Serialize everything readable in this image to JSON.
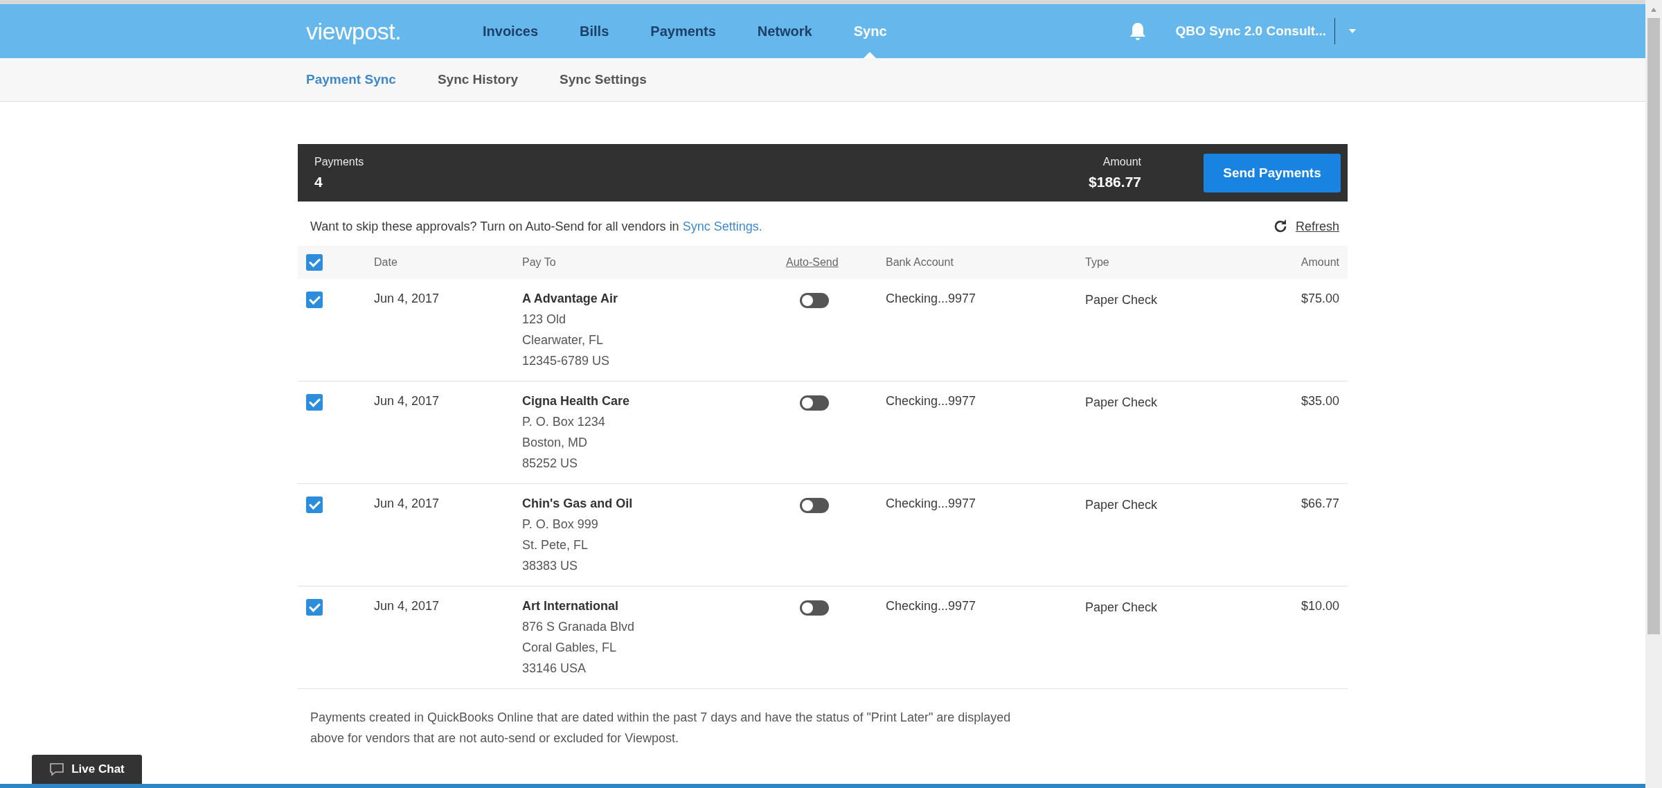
{
  "header": {
    "logo": "viewpost.",
    "nav": [
      {
        "label": "Invoices",
        "selected": false
      },
      {
        "label": "Bills",
        "selected": false
      },
      {
        "label": "Payments",
        "selected": false
      },
      {
        "label": "Network",
        "selected": false
      },
      {
        "label": "Sync",
        "selected": true
      }
    ],
    "account": "QBO Sync 2.0 Consult..."
  },
  "subnav": [
    {
      "label": "Payment Sync",
      "selected": true
    },
    {
      "label": "Sync History",
      "selected": false
    },
    {
      "label": "Sync Settings",
      "selected": false
    }
  ],
  "summary": {
    "payments_label": "Payments",
    "payments_count": "4",
    "amount_label": "Amount",
    "amount": "$186.77",
    "button": "Send Payments"
  },
  "notice": {
    "text": "Want to skip these approvals? Turn on Auto-Send for all vendors in ",
    "link": "Sync Settings.",
    "refresh": "Refresh"
  },
  "table": {
    "select_all_checked": true,
    "columns": [
      "Date",
      "Pay To",
      "Auto-Send",
      "Bank Account",
      "Type",
      "Amount"
    ],
    "rows": [
      {
        "checked": true,
        "date": "Jun 4, 2017",
        "name": "A Advantage Air",
        "address": [
          "123 Old",
          "Clearwater, FL",
          "12345-6789 US"
        ],
        "auto_send": false,
        "bank": "Checking...9977",
        "type": "Paper Check",
        "amount": "$75.00"
      },
      {
        "checked": true,
        "date": "Jun 4, 2017",
        "name": "Cigna Health Care",
        "address": [
          "P. O. Box 1234",
          "Boston, MD",
          "85252 US"
        ],
        "auto_send": false,
        "bank": "Checking...9977",
        "type": "Paper Check",
        "amount": "$35.00"
      },
      {
        "checked": true,
        "date": "Jun 4, 2017",
        "name": "Chin's Gas and Oil",
        "address": [
          "P. O. Box 999",
          "St. Pete, FL",
          "38383 US"
        ],
        "auto_send": false,
        "bank": "Checking...9977",
        "type": "Paper Check",
        "amount": "$66.77"
      },
      {
        "checked": true,
        "date": "Jun 4, 2017",
        "name": "Art International",
        "address": [
          "876 S Granada Blvd",
          "Coral Gables, FL",
          "33146 USA"
        ],
        "auto_send": false,
        "bank": "Checking...9977",
        "type": "Paper Check",
        "amount": "$10.00"
      }
    ]
  },
  "footnote": "Payments created in QuickBooks Online that are dated within the past 7 days and have the status of \"Print Later\" are displayed above for vendors that are not auto-send or excluded for Viewpost.",
  "live_chat": "Live Chat"
}
